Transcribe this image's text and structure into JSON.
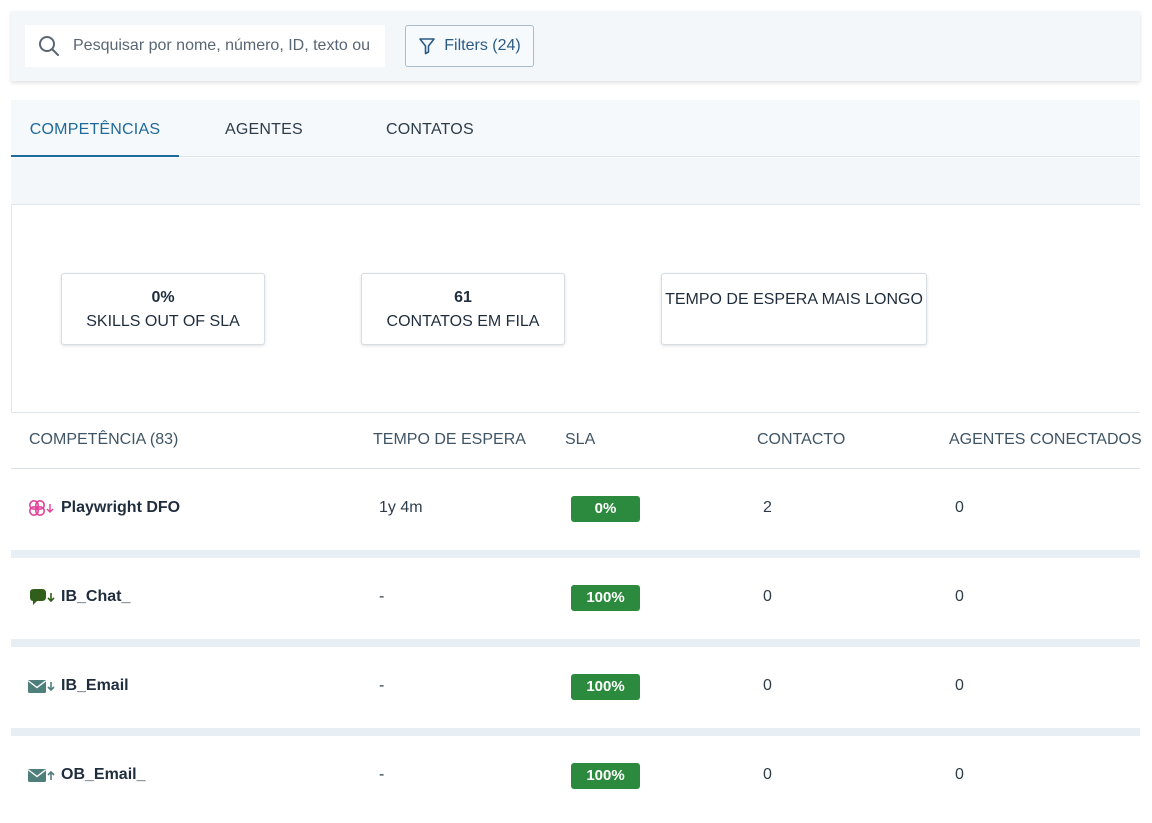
{
  "search": {
    "placeholder": "Pesquisar por nome, número, ID, texto ou"
  },
  "filters": {
    "label": "Filters (24)"
  },
  "tabs": [
    {
      "label": "COMPETÊNCIAS",
      "active": true
    },
    {
      "label": "AGENTES",
      "active": false
    },
    {
      "label": "CONTATOS",
      "active": false
    }
  ],
  "kpis": [
    {
      "value": "0%",
      "label": "SKILLS OUT OF SLA"
    },
    {
      "value": "61",
      "label": "CONTATOS EM FILA"
    },
    {
      "value": "",
      "label": "TEMPO DE ESPERA MAIS LONGO"
    }
  ],
  "table": {
    "headers": [
      "COMPETÊNCIA (83)",
      "TEMPO DE ESPERA",
      "SLA",
      "CONTACTO",
      "AGENTES CONECTADOS"
    ],
    "rows": [
      {
        "icon": "workitem-inbound-icon",
        "name": "Playwright DFO",
        "wait": "1y 4m",
        "sla": "0%",
        "contacts": "2",
        "agents": "0"
      },
      {
        "icon": "chat-inbound-icon",
        "name": "IB_Chat_",
        "wait": "-",
        "sla": "100%",
        "contacts": "0",
        "agents": "0"
      },
      {
        "icon": "email-inbound-icon",
        "name": "IB_Email",
        "wait": "-",
        "sla": "100%",
        "contacts": "0",
        "agents": "0"
      },
      {
        "icon": "email-outbound-icon",
        "name": "OB_Email_",
        "wait": "-",
        "sla": "100%",
        "contacts": "0",
        "agents": "0"
      }
    ]
  },
  "colors": {
    "accent": "#1d6a9b",
    "sla_good": "#2b8a3e",
    "workitem_icon": "#e0429a",
    "chat_icon": "#2f5f1a",
    "email_icon": "#4f7f7a"
  }
}
